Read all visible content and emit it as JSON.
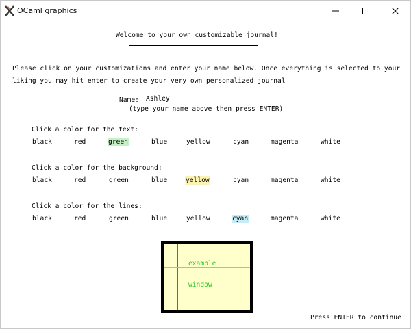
{
  "window": {
    "title": "OCaml graphics",
    "app_icon": "ocaml-x-icon",
    "controls": [
      "minimize-icon",
      "maximize-icon",
      "close-icon"
    ]
  },
  "welcome": "Welcome to your own customizable journal!",
  "intro": {
    "line1": "Please click on your customizations and enter your name below. Once everything is selected to your",
    "line2": "liking you may hit enter to create your very own personalized journal"
  },
  "name": {
    "label": "Name:",
    "value": "Ashley",
    "hint": "(type your name above then press ENTER)"
  },
  "sections": [
    {
      "label": "Click a color for the text:",
      "options": [
        "black",
        "red",
        "green",
        "blue",
        "yellow",
        "cyan",
        "magenta",
        "white"
      ],
      "selected": "green"
    },
    {
      "label": "Click a color for the background:",
      "options": [
        "black",
        "red",
        "green",
        "blue",
        "yellow",
        "cyan",
        "magenta",
        "white"
      ],
      "selected": "yellow"
    },
    {
      "label": "Click a color for the lines:",
      "options": [
        "black",
        "red",
        "green",
        "blue",
        "yellow",
        "cyan",
        "magenta",
        "white"
      ],
      "selected": "cyan"
    }
  ],
  "preview": {
    "line1": "example",
    "line2": "window",
    "text_color": "#22cc22",
    "background_color": "#ffffcc",
    "line_color": "#55ddee",
    "margin_color": "#ff00ff"
  },
  "continue_hint": "Press ENTER to continue",
  "colors": {
    "highlight_green": "#c6f0c6",
    "highlight_yellow": "#fbf3b3",
    "highlight_cyan": "#c8ecf7"
  }
}
